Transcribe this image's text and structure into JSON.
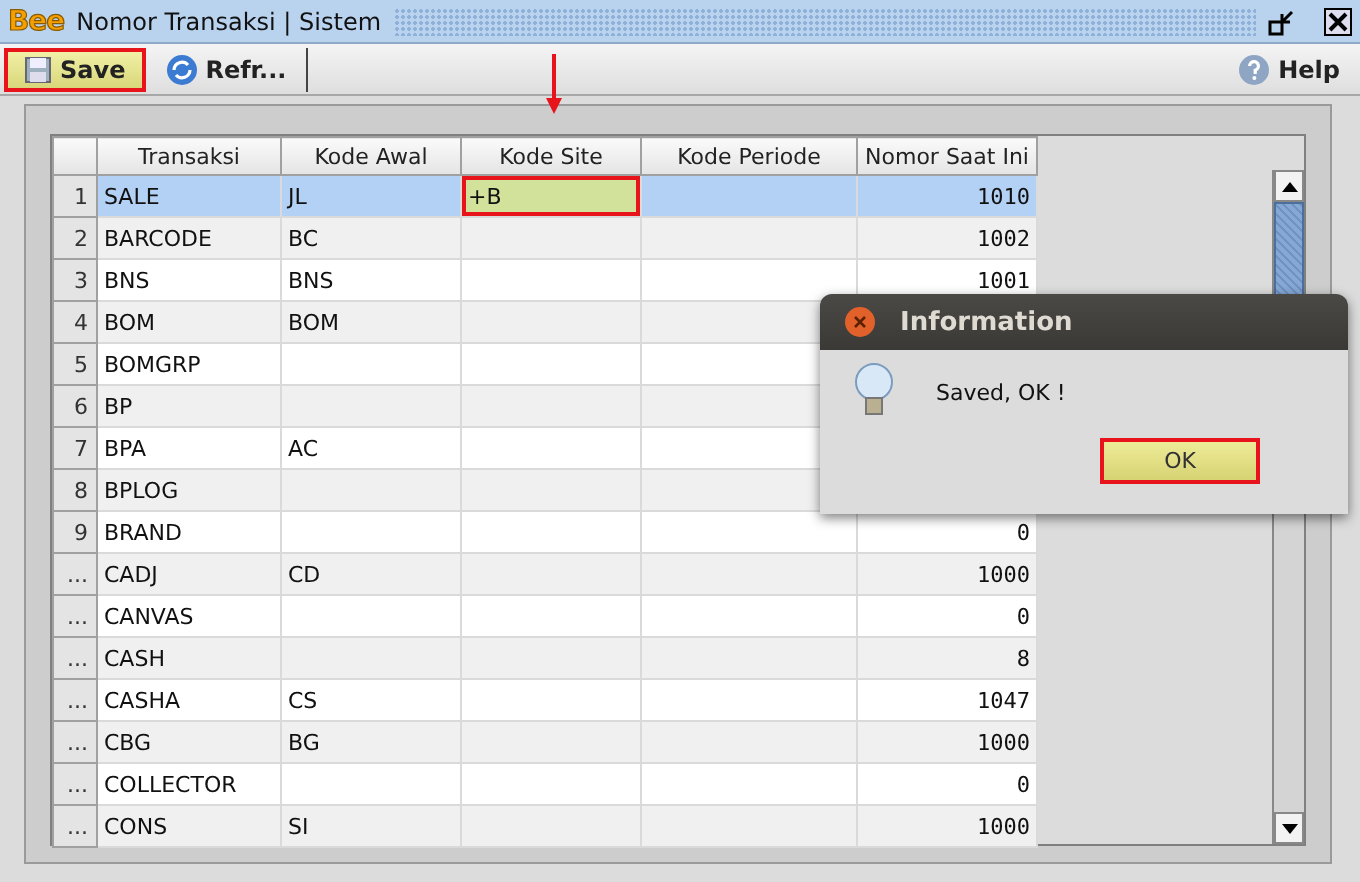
{
  "window": {
    "logo": "Bee",
    "title": "Nomor Transaksi | Sistem"
  },
  "toolbar": [
    {
      "label": "Save",
      "kind": "save",
      "highlighted": true
    },
    {
      "label": "Refr...",
      "kind": "refresh",
      "highlighted": false
    },
    {
      "label": "Help",
      "kind": "help",
      "highlighted": false
    }
  ],
  "table": {
    "columns": [
      "Transaksi",
      "Kode Awal",
      "Kode Site",
      "Kode Periode",
      "Nomor Saat Ini"
    ],
    "rows": [
      {
        "no": "1",
        "cells": [
          "SALE",
          "JL",
          "+B",
          "",
          "1010"
        ],
        "selected": true,
        "editing": true
      },
      {
        "no": "2",
        "cells": [
          "BARCODE",
          "BC",
          "",
          "",
          "1002"
        ],
        "selected": false,
        "editing": false
      },
      {
        "no": "3",
        "cells": [
          "BNS",
          "BNS",
          "",
          "",
          "1001"
        ],
        "selected": false,
        "editing": false
      },
      {
        "no": "4",
        "cells": [
          "BOM",
          "BOM",
          "",
          "",
          ""
        ],
        "selected": false,
        "editing": false
      },
      {
        "no": "5",
        "cells": [
          "BOMGRP",
          "",
          "",
          "",
          ""
        ],
        "selected": false,
        "editing": false
      },
      {
        "no": "6",
        "cells": [
          "BP",
          "",
          "",
          "",
          ""
        ],
        "selected": false,
        "editing": false
      },
      {
        "no": "7",
        "cells": [
          "BPA",
          "AC",
          "",
          "",
          ""
        ],
        "selected": false,
        "editing": false
      },
      {
        "no": "8",
        "cells": [
          "BPLOG",
          "",
          "",
          "",
          ""
        ],
        "selected": false,
        "editing": false
      },
      {
        "no": "9",
        "cells": [
          "BRAND",
          "",
          "",
          "",
          "0"
        ],
        "selected": false,
        "editing": false
      },
      {
        "no": "...",
        "cells": [
          "CADJ",
          "CD",
          "",
          "",
          "1000"
        ],
        "selected": false,
        "editing": false
      },
      {
        "no": "...",
        "cells": [
          "CANVAS",
          "",
          "",
          "",
          "0"
        ],
        "selected": false,
        "editing": false
      },
      {
        "no": "...",
        "cells": [
          "CASH",
          "",
          "",
          "",
          "8"
        ],
        "selected": false,
        "editing": false
      },
      {
        "no": "...",
        "cells": [
          "CASHA",
          "CS",
          "",
          "",
          "1047"
        ],
        "selected": false,
        "editing": false
      },
      {
        "no": "...",
        "cells": [
          "CBG",
          "BG",
          "",
          "",
          "1000"
        ],
        "selected": false,
        "editing": false
      },
      {
        "no": "...",
        "cells": [
          "COLLECTOR",
          "",
          "",
          "",
          "0"
        ],
        "selected": false,
        "editing": false
      },
      {
        "no": "...",
        "cells": [
          "CONS",
          "SI",
          "",
          "",
          "1000"
        ],
        "selected": false,
        "editing": false
      }
    ]
  },
  "dialog": {
    "title": "Information",
    "message": "Saved, OK !",
    "button": {
      "label": "OK",
      "highlighted": true
    }
  }
}
